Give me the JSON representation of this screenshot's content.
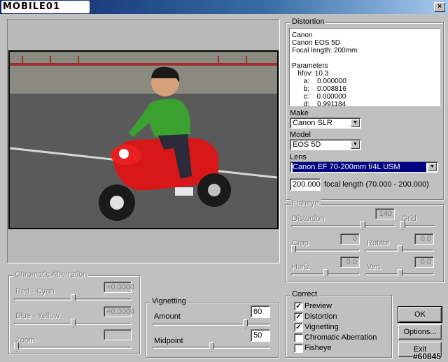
{
  "window": {
    "logo_text": "MOBILE01",
    "close_glyph": "×"
  },
  "distortion": {
    "title": "Distortion",
    "info_text": "Canon\nCanon EOS 5D\nFocal length: 200mm\n\nParameters\n   hfov: 10.3\n      a:    0.000000\n      b:    0.008816\n      c:    0.000000\n      d:    0.991184"
  },
  "make": {
    "label": "Make",
    "value": "Canon SLR"
  },
  "model": {
    "label": "Model",
    "value": "EOS 5D"
  },
  "lens": {
    "label": "Lens",
    "value": "Canon EF 70-200mm f/4L USM"
  },
  "focal": {
    "value": "200.000",
    "label": "focal length (70.000 - 200.000)"
  },
  "fisheye": {
    "title": "Fisheye",
    "distortion_label": "Distortion",
    "distortion_value": "140",
    "grid_label": "Grid",
    "crop_label": "Crop",
    "crop_value": "0",
    "rotate_label": "Rotate",
    "rotate_value": "0.0",
    "horiz_label": "Horiz",
    "horiz_value": "0.0",
    "vert_label": "Vert",
    "vert_value": "0.0"
  },
  "chromatic": {
    "title": "Chromatic Aberration",
    "red_cyan_label": "Red - Cyan",
    "red_cyan_value": "+0.0000",
    "blue_yellow_label": "Blue - Yellow",
    "blue_yellow_value": "+0.0000",
    "zoom_label": "Zoom"
  },
  "vignetting": {
    "title": "Vignetting",
    "amount_label": "Amount",
    "amount_value": "60",
    "amount_level": 0.8,
    "midpoint_label": "Midpoint",
    "midpoint_value": "50",
    "midpoint_level": 0.5
  },
  "correct": {
    "title": "Correct",
    "items": [
      {
        "label": "Preview",
        "checked": true
      },
      {
        "label": "Distortion",
        "checked": true
      },
      {
        "label": "Vignetting",
        "checked": true
      },
      {
        "label": "Chromatic Aberration",
        "checked": false
      },
      {
        "label": "Fisheye",
        "checked": false
      }
    ]
  },
  "buttons": {
    "ok": "OK",
    "options": "Options...",
    "exit": "Exit"
  },
  "watermark": "#60845",
  "colors": {
    "title_bar": "#0a246a",
    "selection": "#000080",
    "face": "#c0c0c0",
    "bike": "#e01010",
    "shirt": "#3aa030"
  }
}
